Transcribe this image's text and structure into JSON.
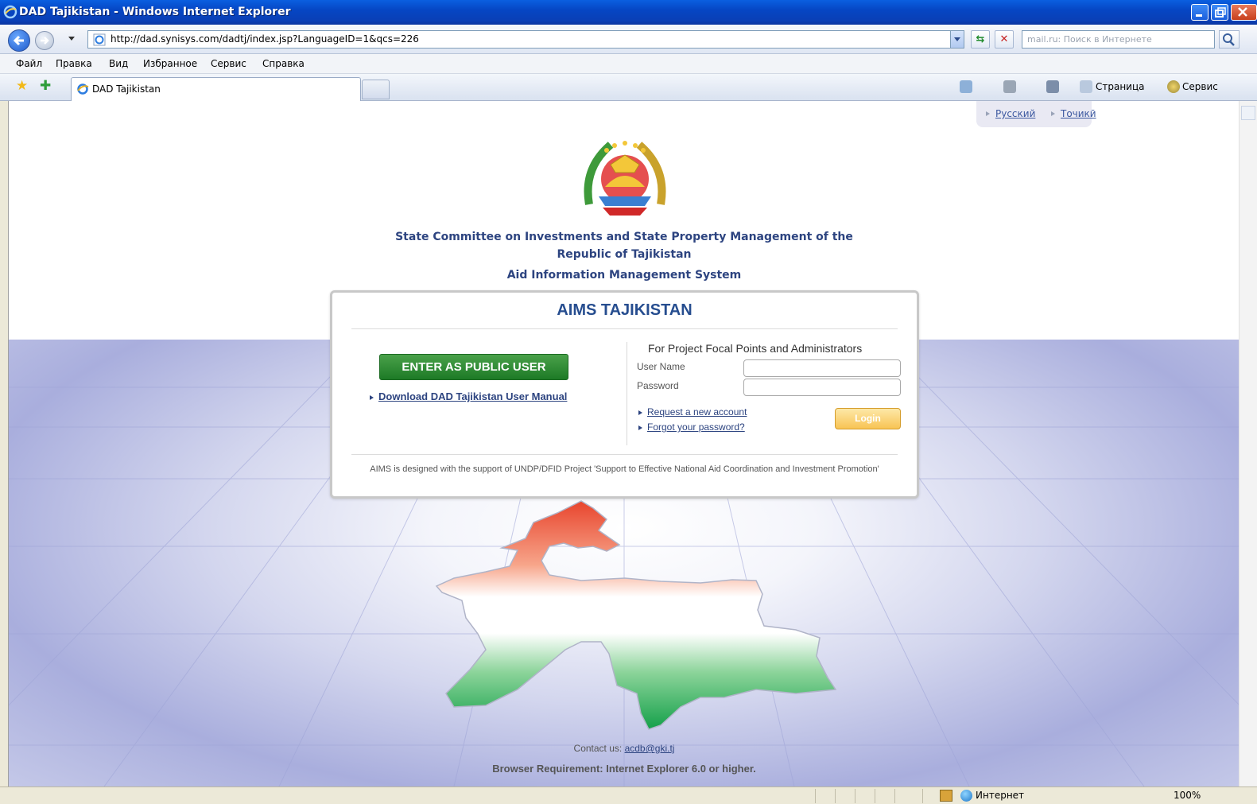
{
  "window": {
    "title": "DAD Tajikistan - Windows Internet Explorer"
  },
  "address_bar": {
    "url": "http://dad.synisys.com/dadtj/index.jsp?LanguageID=1&qcs=226",
    "search_placeholder": "mail.ru: Поиск в Интернете"
  },
  "menu": {
    "items": [
      "Файл",
      "Правка",
      "Вид",
      "Избранное",
      "Сервис",
      "Справка"
    ]
  },
  "tabs": {
    "active_tab": "DAD Tajikistan"
  },
  "command_bar": {
    "page_label": "Страница",
    "tools_label": "Сервис"
  },
  "page": {
    "languages": [
      "Русский",
      "Точикӣ"
    ],
    "org_line1": "State Committee on Investments and State Property Management of the",
    "org_line2": "Republic of Tajikistan",
    "system_name": "Aid Information Management System",
    "panel_title": "AIMS TAJIKISTAN",
    "public_user_button": "ENTER AS PUBLIC USER",
    "manual_link": "Download DAD Tajikistan User Manual",
    "focal_heading": "For Project Focal Points and Administrators",
    "username_label": "User Name",
    "password_label": "Password",
    "request_account_link": "Request a new account",
    "forgot_password_link": "Forgot your password?",
    "login_button": "Login",
    "support_text": "AIMS is designed with the support of UNDP/DFID Project 'Support to Effective National Aid Coordination and Investment Promotion'",
    "contact_label": "Contact us:",
    "contact_email": "acdb@gki.tj",
    "browser_requirement": "Browser Requirement: Internet Explorer 6.0 or higher."
  },
  "status_bar": {
    "zone": "Интернет",
    "zoom": "100%"
  },
  "colors": {
    "titlebar": "#0646c4",
    "heading_blue": "#2d4480",
    "public_button_green": "#1d7a26",
    "login_button_orange": "#f8c454"
  }
}
